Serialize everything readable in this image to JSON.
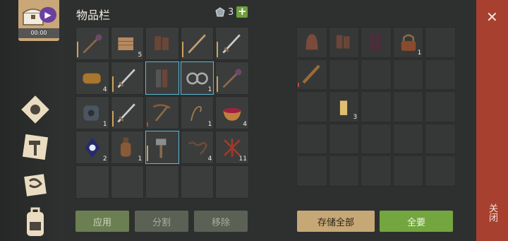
{
  "sidebar": {
    "timer": "00:00",
    "items": [
      {
        "icon": "chest-icon"
      },
      {
        "icon": "sun-icon"
      },
      {
        "icon": "hammer-icon"
      },
      {
        "icon": "scroll-icon"
      },
      {
        "icon": "backpack-icon"
      }
    ]
  },
  "inventory": {
    "title": "物品栏",
    "currency_value": "3",
    "plus_label": "+",
    "rows": [
      [
        {
          "icon": "spiked-mace-icon",
          "qty": "",
          "durability": true
        },
        {
          "icon": "cloth-bundle-icon",
          "qty": "5"
        },
        {
          "icon": "gloves-icon",
          "qty": ""
        },
        {
          "icon": "wooden-spear-icon",
          "qty": "",
          "durability": true
        },
        {
          "icon": "sword-icon",
          "qty": "",
          "durability": true
        }
      ],
      [
        {
          "icon": "bread-ingot-icon",
          "qty": "4"
        },
        {
          "icon": "sword-icon",
          "qty": "",
          "durability": true
        },
        {
          "icon": "leg-armor-icon",
          "qty": "",
          "selected": true
        },
        {
          "icon": "handcuffs-icon",
          "qty": "1",
          "selected": true
        },
        {
          "icon": "spiked-mace-icon",
          "qty": "",
          "durability": true
        }
      ],
      [
        {
          "icon": "gear-cylinder-icon",
          "qty": "1"
        },
        {
          "icon": "sword-icon",
          "qty": "",
          "durability": true
        },
        {
          "icon": "crossbow-icon",
          "qty": "",
          "durability_red": true
        },
        {
          "icon": "rope-icon",
          "qty": "1"
        },
        {
          "icon": "berry-bowl-icon",
          "qty": "4"
        }
      ],
      [
        {
          "icon": "crystal-icon",
          "qty": "2"
        },
        {
          "icon": "bottle-icon",
          "qty": "1"
        },
        {
          "icon": "sledgehammer-icon",
          "qty": "",
          "selected": true,
          "durability": true
        },
        {
          "icon": "chain-icon",
          "qty": "4"
        },
        {
          "icon": "red-rope-icon",
          "qty": "11"
        }
      ],
      [
        {
          "icon": "",
          "qty": ""
        },
        {
          "icon": "",
          "qty": ""
        },
        {
          "icon": "",
          "qty": ""
        },
        {
          "icon": "",
          "qty": ""
        },
        {
          "icon": "",
          "qty": ""
        }
      ]
    ],
    "buttons": {
      "apply": "应用",
      "split": "分割",
      "remove": "移除"
    }
  },
  "storage": {
    "rows": [
      [
        {
          "icon": "hood-icon",
          "qty": ""
        },
        {
          "icon": "gloves-icon",
          "qty": ""
        },
        {
          "icon": "pants-icon",
          "qty": ""
        },
        {
          "icon": "padlock-icon",
          "qty": "1"
        },
        {
          "icon": "",
          "qty": ""
        }
      ],
      [
        {
          "icon": "spiked-club-icon",
          "qty": "",
          "durability_red": true
        },
        {
          "icon": "",
          "qty": ""
        },
        {
          "icon": "",
          "qty": ""
        },
        {
          "icon": "",
          "qty": ""
        },
        {
          "icon": "",
          "qty": ""
        }
      ],
      [
        {
          "icon": "",
          "qty": ""
        },
        {
          "icon": "candle-icon",
          "qty": "3"
        },
        {
          "icon": "",
          "qty": ""
        },
        {
          "icon": "",
          "qty": ""
        },
        {
          "icon": "",
          "qty": ""
        }
      ],
      [
        {
          "icon": "",
          "qty": ""
        },
        {
          "icon": "",
          "qty": ""
        },
        {
          "icon": "",
          "qty": ""
        },
        {
          "icon": "",
          "qty": ""
        },
        {
          "icon": "",
          "qty": ""
        }
      ],
      [
        {
          "icon": "",
          "qty": ""
        },
        {
          "icon": "",
          "qty": ""
        },
        {
          "icon": "",
          "qty": ""
        },
        {
          "icon": "",
          "qty": ""
        },
        {
          "icon": "",
          "qty": ""
        }
      ]
    ],
    "buttons": {
      "store_all": "存储全部",
      "take_all": "全要"
    }
  },
  "close": {
    "label": "关闭",
    "icon": "close-icon"
  },
  "colors": {
    "accent_green": "#73a63e",
    "accent_gold": "#c6a776",
    "close_red": "#a7402f",
    "selected_border": "#5bb7d6"
  }
}
